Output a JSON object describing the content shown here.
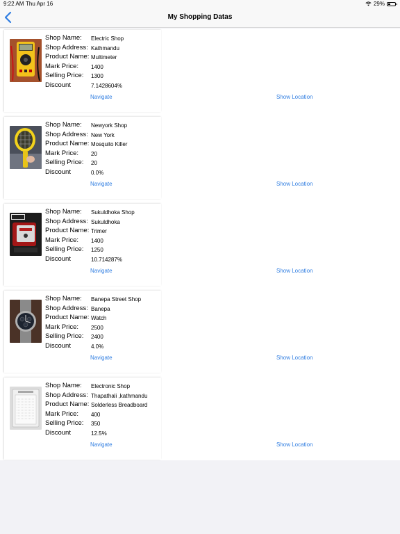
{
  "status_bar": {
    "time": "9:22 AM",
    "date": "Thu Apr 16",
    "battery_text": "29%",
    "battery_level": 0.29
  },
  "nav": {
    "title": "My Shopping Datas",
    "back_icon": "chevron-left-icon"
  },
  "labels": {
    "shop_name": "Shop Name:",
    "shop_address": "Shop Address:",
    "product_name": "Product Name:",
    "mark_price": "Mark Price:",
    "selling_price": "Selling Price:",
    "discount": "Discount",
    "navigate": "Navigate",
    "show_location": "Show Location"
  },
  "colors": {
    "link": "#2f7de1",
    "accent": "#2f7de1"
  },
  "items": [
    {
      "shop_name": "Electric Shop",
      "shop_address": "Kathmandu",
      "product_name": "Multimeter",
      "mark_price": "1400",
      "selling_price": "1300",
      "discount": "7.1428604%",
      "image": "multimeter-photo"
    },
    {
      "shop_name": "Newyork Shop",
      "shop_address": "New York",
      "product_name": "Mosquito Killer",
      "mark_price": "20",
      "selling_price": "20",
      "discount": "0.0%",
      "image": "mosquito-killer-photo"
    },
    {
      "shop_name": "Sukuldhoka Shop",
      "shop_address": "Sukuldhoka",
      "product_name": "Trimer",
      "mark_price": "1400",
      "selling_price": "1250",
      "discount": "10.714287%",
      "image": "trimmer-photo"
    },
    {
      "shop_name": "Banepa Street Shop",
      "shop_address": "Banepa",
      "product_name": "Watch",
      "mark_price": "2500",
      "selling_price": "2400",
      "discount": "4.0%",
      "image": "watch-photo"
    },
    {
      "shop_name": "Electronic Shop",
      "shop_address": "Thapathali ,kathmandu",
      "product_name": "Solderless Breadboard",
      "mark_price": "400",
      "selling_price": "350",
      "discount": "12.5%",
      "image": "breadboard-photo"
    }
  ]
}
